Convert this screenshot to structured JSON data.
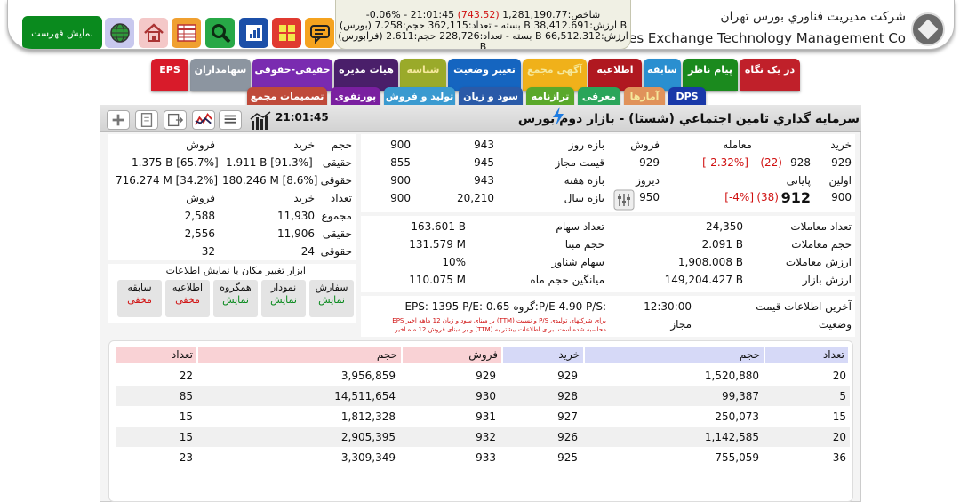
{
  "header": {
    "company_fa": "شرکت مدیریت فناوري بورس تهران",
    "company_en": "urities Exchange Technology Management Co",
    "show_list_label": "نمایش فهرست",
    "ticker": {
      "line1_prefix": "شاخص:1,281,190.77",
      "line1_change": "(743.52)",
      "line1_suffix": "-0.06% - 21:01:45",
      "line2": "(بورس) بسته - تعداد:362,115 حجم:7.258 B ارزش:38,412.691 B",
      "line3": "(فرابورس) بسته - تعداد:228,726 حجم:2.611 B ارزش:66,512.312 B"
    },
    "icons": [
      "globe-icon",
      "home-icon",
      "table-icon",
      "search-icon",
      "chart-book-icon",
      "grid-icon",
      "chat-icon"
    ]
  },
  "tabs_row1": [
    {
      "label": "در یک نگاه",
      "color": "#c0202a"
    },
    {
      "label": "پیام ناظر",
      "color": "#1b8a1e"
    },
    {
      "label": "سابقه",
      "color": "#2a8fd0"
    },
    {
      "label": "اطلاعیه",
      "color": "#b01820"
    },
    {
      "label": "آگهی مجمع",
      "color": "#f0b11a"
    },
    {
      "label": "تغییر وضعیت",
      "color": "#1565c0"
    },
    {
      "label": "شناسه",
      "color": "#9aaa2a"
    },
    {
      "label": "هیات مدیره",
      "color": "#4a1f6a"
    },
    {
      "label": "حقیقی-حقوقی",
      "color": "#7a2bb0"
    },
    {
      "label": "سهامداران",
      "color": "#8c95a0"
    },
    {
      "label": "EPS",
      "color": "#d81b2a"
    }
  ],
  "tabs_row2": [
    {
      "label": "DPS",
      "color": "#1838a8"
    },
    {
      "label": "آمارها",
      "color": "#e0925a"
    },
    {
      "label": "معرفی",
      "color": "#2aa55a"
    },
    {
      "label": "ترازنامه",
      "color": "#5aa82a"
    },
    {
      "label": "سود و زیان",
      "color": "#2a5aa8"
    },
    {
      "label": "تولید و فروش",
      "color": "#3a9ad0"
    },
    {
      "label": "پورتفوی",
      "color": "#7a1fa0"
    },
    {
      "label": "تصمیمات مجمع",
      "color": "#bf4a3a"
    }
  ],
  "symbol": {
    "title": "سرمایه گذاري تامین اجتماعي (شستا) - بازار دوم بورس",
    "time": "21:01:45"
  },
  "price": {
    "h_buy": "خرید",
    "h_trade": "معامله",
    "h_sell": "فروش",
    "buy1": "929",
    "trade_last": "928",
    "trade_change": "(22)",
    "trade_pct": "[-2.32%]",
    "sell1": "929",
    "buy2": "900",
    "trade_close": "912",
    "close_change": "(38)",
    "close_pct": "[-4%]",
    "sell2": "950",
    "label_first": "اولین",
    "label_final": "پایانی",
    "label_yesterday": "دیروز",
    "ranges": [
      {
        "label": "بازه روز",
        "a": "943",
        "b": "900"
      },
      {
        "label": "قیمت مجاز",
        "a": "945",
        "b": "855"
      },
      {
        "label": "بازه هفته",
        "a": "943",
        "b": "900"
      },
      {
        "label": "بازه سال",
        "a": "20,210",
        "b": "900"
      }
    ]
  },
  "legal_real": {
    "h_volume": "حجم",
    "h_buy": "خرید",
    "h_sell": "فروش",
    "real_label": "حقیقی",
    "real_buy": "1.911 B [91.3%]",
    "real_sell": "1.375 B [65.7%]",
    "legal_label": "حقوقی",
    "legal_buy": "180.246 M [8.6%]",
    "legal_sell": "716.274 M [34.2%]",
    "h_count": "تعداد",
    "h_buy2": "خرید",
    "h_sell2": "فروش",
    "rows": [
      {
        "label": "مجموع",
        "buy": "11,930",
        "sell": "2,588"
      },
      {
        "label": "حقیقی",
        "buy": "11,906",
        "sell": "2,556"
      },
      {
        "label": "حقوقی",
        "buy": "24",
        "sell": "32"
      }
    ]
  },
  "stats": [
    {
      "label": "تعداد معاملات",
      "value": "24,350"
    },
    {
      "label": "حجم معاملات",
      "value": "2.091 B"
    },
    {
      "label": "ارزش معاملات",
      "value": "1,908.008 B"
    },
    {
      "label": "ارزش بازار",
      "value": "149,204.427 B"
    }
  ],
  "shares": [
    {
      "label": "تعداد سهام",
      "value": "163.601 B"
    },
    {
      "label": "حجم مبنا",
      "value": "131.579 M"
    },
    {
      "label": "سهام شناور",
      "value": "10%"
    },
    {
      "label": "میانگین حجم ماه",
      "value": "110.075 M"
    }
  ],
  "info": {
    "last_update_label": "آخرین اطلاعات قیمت",
    "last_update_value": "12:30:00",
    "status_label": "وضعیت",
    "status_value": "مجاز",
    "ratios": "EPS:  1395  P/E:  0.65  گروه:P/E  4.90  P/S:",
    "note_line1": "EPS بر مبنای سود و زیان 12 ماهه اخیر (TTM) و نسبت P/S برای شرکتهای تولیدی",
    "note_line2": "و بر مبنای فروش 12 ماه اخیر (TTM) محاسبه شده است. برای اطلاعات بیشتر به"
  },
  "display_tools": {
    "title": "ابزار تغییر مکان یا نمایش اطلاعات",
    "items": [
      {
        "label": "سفارش",
        "state": "نمایش",
        "shown": true
      },
      {
        "label": "نمودار",
        "state": "نمایش",
        "shown": true
      },
      {
        "label": "همگروه",
        "state": "نمایش",
        "shown": true
      },
      {
        "label": "اطلاعیه",
        "state": "مخفی",
        "shown": false
      },
      {
        "label": "سابقه",
        "state": "مخفی",
        "shown": false
      }
    ]
  },
  "orderbook": {
    "headers": {
      "count_buy": "تعداد",
      "volume_buy": "حجم",
      "price_buy": "خرید",
      "price_sell": "فروش",
      "volume_sell": "حجم",
      "count_sell": "تعداد"
    },
    "rows": [
      {
        "count_buy": "20",
        "volume_buy": "1,520,880",
        "price_buy": "929",
        "price_sell": "929",
        "volume_sell": "3,956,859",
        "count_sell": "22"
      },
      {
        "count_buy": "5",
        "volume_buy": "99,387",
        "price_buy": "928",
        "price_sell": "930",
        "volume_sell": "14,511,654",
        "count_sell": "85"
      },
      {
        "count_buy": "15",
        "volume_buy": "250,073",
        "price_buy": "927",
        "price_sell": "931",
        "volume_sell": "1,812,328",
        "count_sell": "15"
      },
      {
        "count_buy": "20",
        "volume_buy": "1,142,585",
        "price_buy": "926",
        "price_sell": "932",
        "volume_sell": "2,905,395",
        "count_sell": "15"
      },
      {
        "count_buy": "36",
        "volume_buy": "755,059",
        "price_buy": "925",
        "price_sell": "933",
        "volume_sell": "3,309,349",
        "count_sell": "23"
      }
    ]
  }
}
